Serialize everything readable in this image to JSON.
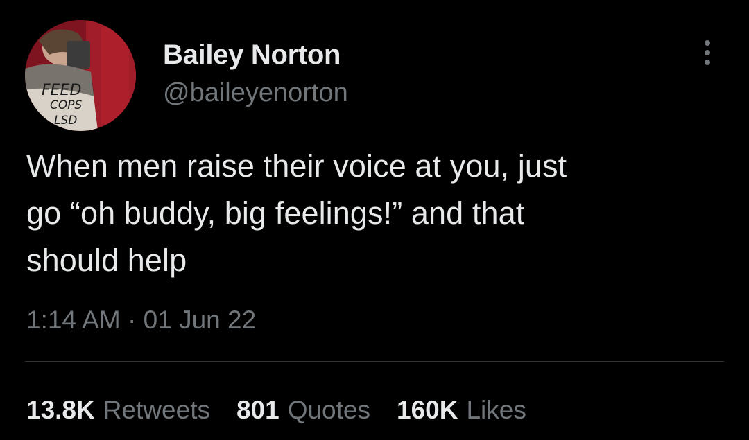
{
  "colors": {
    "background": "#000000",
    "primary_text": "#e7e9ea",
    "secondary_text": "#71767b",
    "divider": "#2f3336"
  },
  "author": {
    "display_name": "Bailey Norton",
    "handle": "@baileyenorton",
    "avatar_text": {
      "line1": "FEED",
      "line2": "COPS",
      "line3": "LSD"
    }
  },
  "tweet": {
    "text": "When men raise their voice at you, just\ngo “oh buddy, big feelings!” and that\nshould help",
    "time": "1:14 AM",
    "separator": "·",
    "date": "01 Jun 22"
  },
  "stats": {
    "retweets": {
      "count": "13.8K",
      "label": "Retweets"
    },
    "quotes": {
      "count": "801",
      "label": "Quotes"
    },
    "likes": {
      "count": "160K",
      "label": "Likes"
    }
  },
  "icons": {
    "more": "more-vertical-icon"
  }
}
